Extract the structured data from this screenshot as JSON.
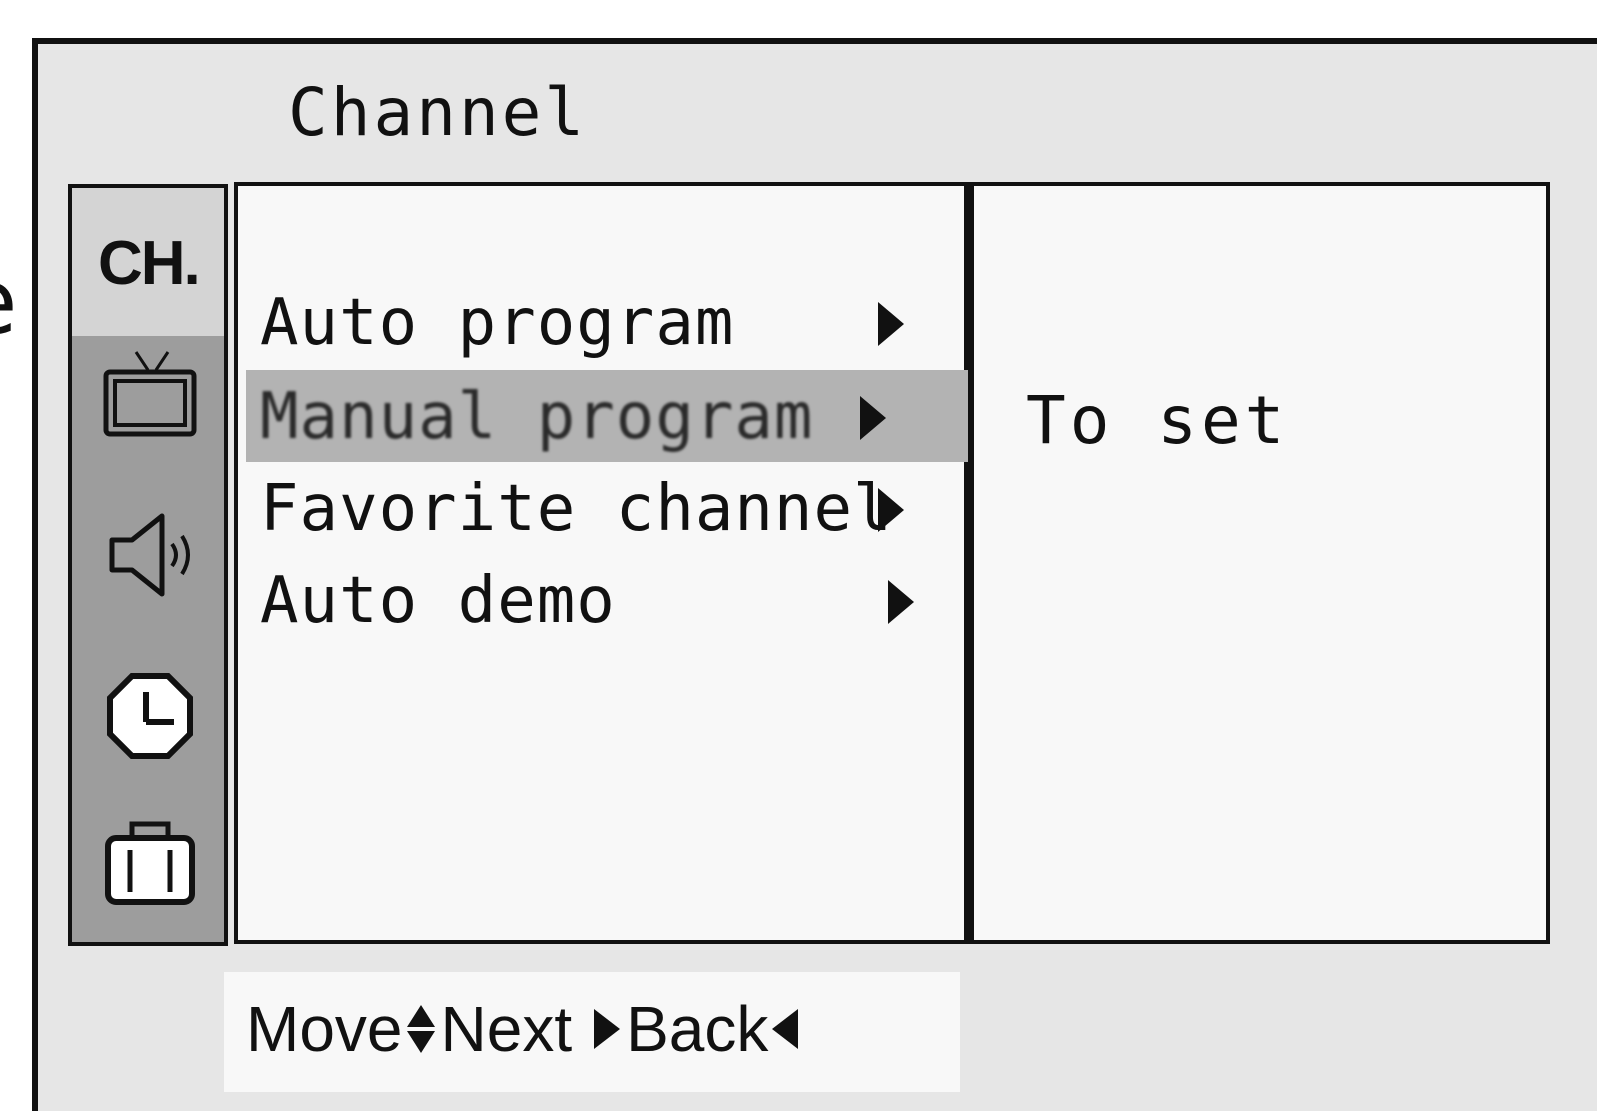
{
  "osd": {
    "title": "Channel",
    "category": {
      "current_label": "CH.",
      "icons": [
        "tv-icon",
        "speaker-icon",
        "clock-icon",
        "toolbox-icon"
      ]
    },
    "menu": {
      "items": [
        {
          "label": "Auto program",
          "icon": "right-arrow-icon",
          "selected": false
        },
        {
          "label": "Manual program",
          "icon": "right-arrow-icon",
          "selected": true
        },
        {
          "label": "Favorite channel",
          "icon": "right-arrow-icon",
          "selected": false
        },
        {
          "label": "Auto demo",
          "icon": "right-arrow-icon",
          "selected": false
        }
      ]
    },
    "description": "To set",
    "footer": {
      "move_label": "Move",
      "next_label": "Next",
      "back_label": "Back",
      "icons": [
        "up-down-arrow-icon",
        "right-arrow-icon",
        "left-arrow-icon"
      ]
    }
  },
  "colors": {
    "panel_bg": "#e6e6e6",
    "list_bg": "#f8f8f8",
    "rail_bg": "#9d9d9d",
    "selection_bg": "#b3b3b3",
    "border": "#111111"
  }
}
